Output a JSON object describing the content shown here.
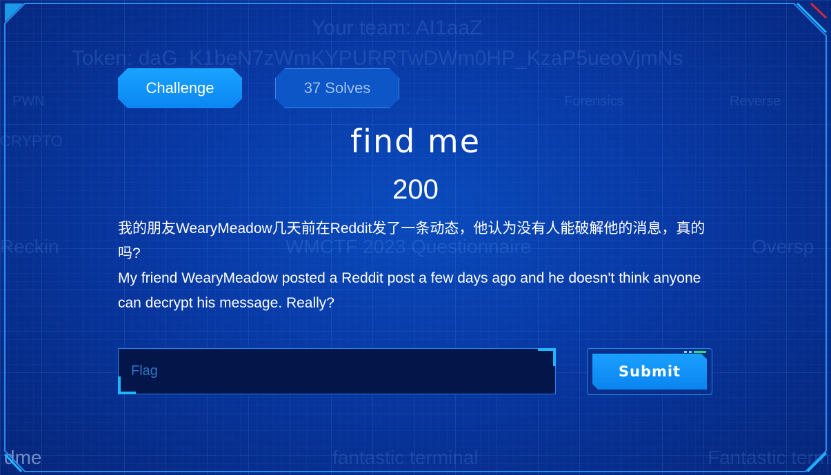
{
  "background": {
    "team_line": "Your team: AI1aaZ",
    "token_line": "Token: daG_K1beN7zWmKYPURRTwDWm0HP_KzaP5ueoVjmNs",
    "category_top_left": "PWN",
    "category_top_mid": "Forensics",
    "category_top_right": "Reverse",
    "category_left": "CRYPTO",
    "mid_left": "Reckin",
    "mid_center": "WMCTF 2023 Questionnaire",
    "mid_right": "Oversp",
    "bottom_left": "dme",
    "bottom_center": "fantastic terminal",
    "bottom_right": "Fantastic term"
  },
  "tabs": {
    "challenge_label": "Challenge",
    "solves_label": "37 Solves"
  },
  "challenge": {
    "name": "find me",
    "value": "200",
    "description_zh": "我的朋友WearyMeadow几天前在Reddit发了一条动态，他认为没有人能破解他的消息，真的吗?",
    "description_en": "My friend WearyMeadow posted a Reddit post a few days ago and he doesn't think anyone can decrypt his message. Really?"
  },
  "form": {
    "flag_placeholder": "Flag",
    "submit_label": "Submit"
  },
  "colors": {
    "accent": "#0a8cf5",
    "background": "#0838a3",
    "input_bg": "#04154a",
    "deco_green": "#2ce06b"
  }
}
